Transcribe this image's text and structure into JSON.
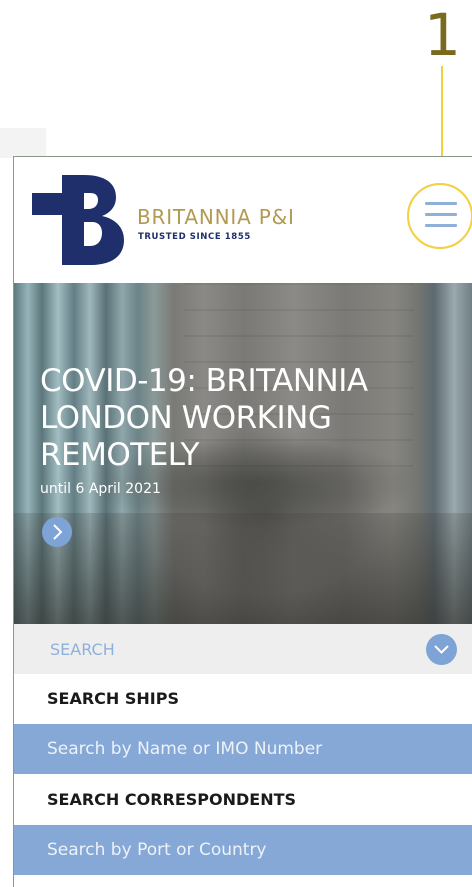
{
  "annotation": {
    "number": "1"
  },
  "brand": {
    "name": "BRITANNIA P&I",
    "tagline": "TRUSTED SINCE 1855",
    "logo_color": "#1f2f6c",
    "name_color": "#b29a52"
  },
  "header": {
    "menu_icon": "hamburger-menu-icon"
  },
  "hero": {
    "title": "COVID-19: BRITANNIA LONDON WORKING REMOTELY",
    "subtitle": "until 6 April 2021",
    "next_icon": "chevron-right-icon"
  },
  "search": {
    "label": "SEARCH",
    "toggle_icon": "chevron-down-icon",
    "ships": {
      "heading": "SEARCH SHIPS",
      "placeholder": "Search by Name or IMO Number"
    },
    "correspondents": {
      "heading": "SEARCH CORRESPONDENTS",
      "placeholder": "Search by Port or Country"
    }
  },
  "colors": {
    "accent": "#86a8d6",
    "highlight": "#f2cf3c"
  }
}
